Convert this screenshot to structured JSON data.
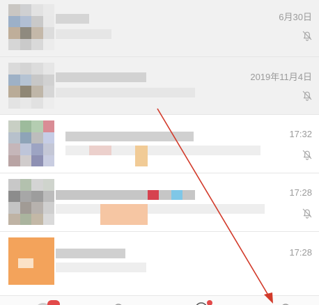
{
  "chats": [
    {
      "time": "6月30日",
      "muted": true
    },
    {
      "time": "2019年11月4日",
      "muted": true
    },
    {
      "time": "17:32",
      "muted": true
    },
    {
      "time": "17:28",
      "muted": true
    },
    {
      "time": "17:28",
      "muted": false
    }
  ],
  "icons": {
    "bell_muted": "bell-off-icon"
  },
  "colors": {
    "annotation_arrow": "#d23a2a",
    "badge": "#e24a4a",
    "time_text": "#9b9b9b"
  }
}
